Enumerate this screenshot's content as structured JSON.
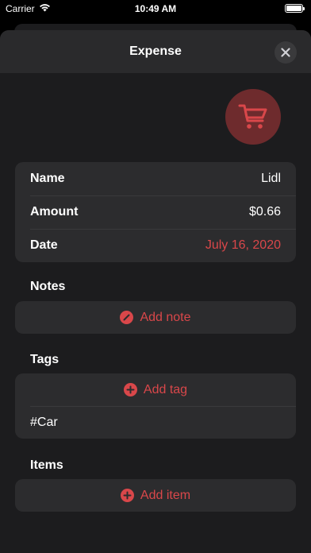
{
  "status_bar": {
    "carrier": "Carrier",
    "time": "10:49 AM"
  },
  "nav": {
    "title": "Expense"
  },
  "details": {
    "name_label": "Name",
    "name_value": "Lidl",
    "amount_label": "Amount",
    "amount_value": "$0.66",
    "date_label": "Date",
    "date_value": "July 16, 2020"
  },
  "notes": {
    "header": "Notes",
    "add_label": "Add note"
  },
  "tags": {
    "header": "Tags",
    "add_label": "Add tag",
    "items": [
      "#Car"
    ]
  },
  "items": {
    "header": "Items",
    "add_label": "Add item"
  },
  "colors": {
    "accent": "#d9474a",
    "background": "#1c1c1e",
    "card": "#2c2c2e"
  },
  "icons": {
    "category": "shopping-cart-icon",
    "close": "close-icon"
  }
}
